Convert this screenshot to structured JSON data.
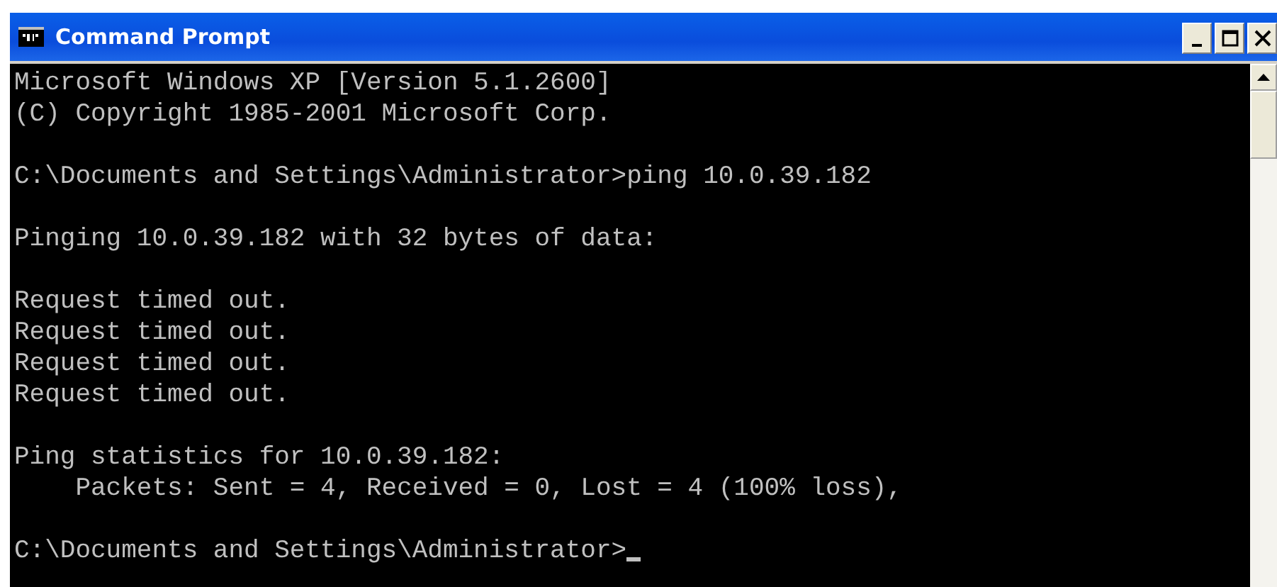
{
  "window": {
    "title": "Command Prompt"
  },
  "console": {
    "blocks": [
      [
        "Microsoft Windows XP [Version 5.1.2600]",
        "(C) Copyright 1985-2001 Microsoft Corp."
      ],
      [
        "C:\\Documents and Settings\\Administrator>ping 10.0.39.182"
      ],
      [
        "Pinging 10.0.39.182 with 32 bytes of data:"
      ],
      [
        "Request timed out.",
        "Request timed out.",
        "Request timed out.",
        "Request timed out."
      ],
      [
        "Ping statistics for 10.0.39.182:",
        "    Packets: Sent = 4, Received = 0, Lost = 4 (100% loss),"
      ],
      [
        "C:\\Documents and Settings\\Administrator>"
      ]
    ],
    "cursor": true
  }
}
